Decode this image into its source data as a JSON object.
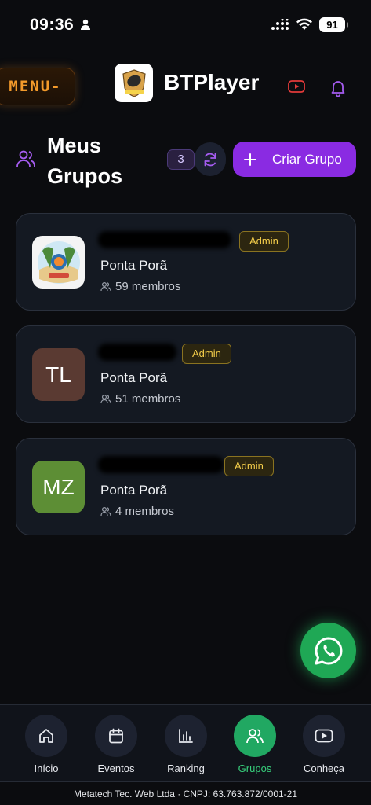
{
  "status_bar": {
    "time": "09:36",
    "battery": "91"
  },
  "header": {
    "menu_label": "MENU",
    "logo_text": "BTPlayer",
    "app_title": "BTPlayer"
  },
  "section": {
    "title": "Meus Grupos",
    "count": "3",
    "create_label": "Criar Grupo"
  },
  "groups": [
    {
      "initials": "",
      "city": "Ponta Porã",
      "members": "59 membros",
      "admin_label": "Admin",
      "avatar_color": "#f4f4f4"
    },
    {
      "initials": "TL",
      "city": "Ponta Porã",
      "members": "51 membros",
      "admin_label": "Admin",
      "avatar_color": "#5a3a32"
    },
    {
      "initials": "MZ",
      "city": "Ponta Porã",
      "members": "4 membros",
      "admin_label": "Admin",
      "avatar_color": "#5d8e35"
    }
  ],
  "nav": [
    {
      "label": "Início",
      "icon": "home-icon"
    },
    {
      "label": "Eventos",
      "icon": "calendar-icon"
    },
    {
      "label": "Ranking",
      "icon": "bar-chart-icon"
    },
    {
      "label": "Grupos",
      "icon": "users-icon",
      "active": true
    },
    {
      "label": "Conheça",
      "icon": "youtube-icon"
    }
  ],
  "footer": "Metatech Tec. Web Ltda · CNPJ: 63.763.872/0001-21",
  "colors": {
    "accent": "#8a2be2",
    "active_nav": "#21a862",
    "admin": "#f2cc4a",
    "menu": "#f39a2b"
  }
}
